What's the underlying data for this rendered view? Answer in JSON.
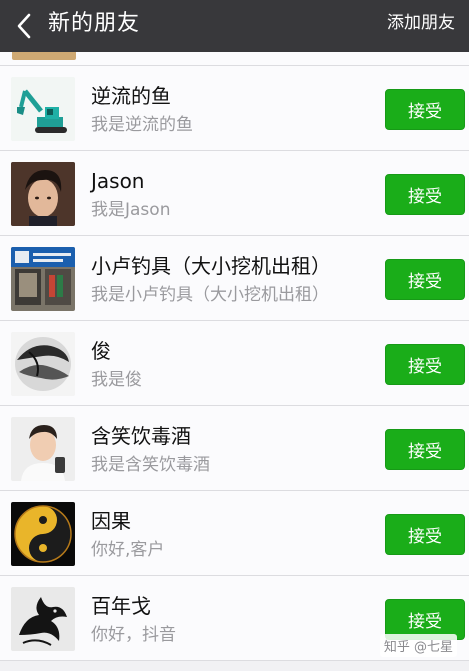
{
  "header": {
    "title": "新的朋友",
    "add_friend_label": "添加朋友"
  },
  "requests": [
    {
      "name": "逆流的鱼",
      "message": "我是逆流的鱼",
      "accept_label": "接受"
    },
    {
      "name": "Jason",
      "message": "我是Jason",
      "accept_label": "接受"
    },
    {
      "name": "小卢钓具（大小挖机出租）",
      "message": "我是小卢钓具（大小挖机出租）",
      "accept_label": "接受"
    },
    {
      "name": "俊",
      "message": "我是俊",
      "accept_label": "接受"
    },
    {
      "name": "含笑饮毒酒",
      "message": "我是含笑饮毒酒",
      "accept_label": "接受"
    },
    {
      "name": "因果",
      "message": "你好,客户",
      "accept_label": "接受"
    },
    {
      "name": "百年戈",
      "message": "你好，抖音",
      "accept_label": "接受"
    }
  ],
  "watermark": "知乎 @七星",
  "colors": {
    "topbar": "#38383b",
    "accept_button": "#1aad19",
    "background": "#f1f1f4"
  },
  "icons": {
    "back": "chevron-left-icon"
  }
}
